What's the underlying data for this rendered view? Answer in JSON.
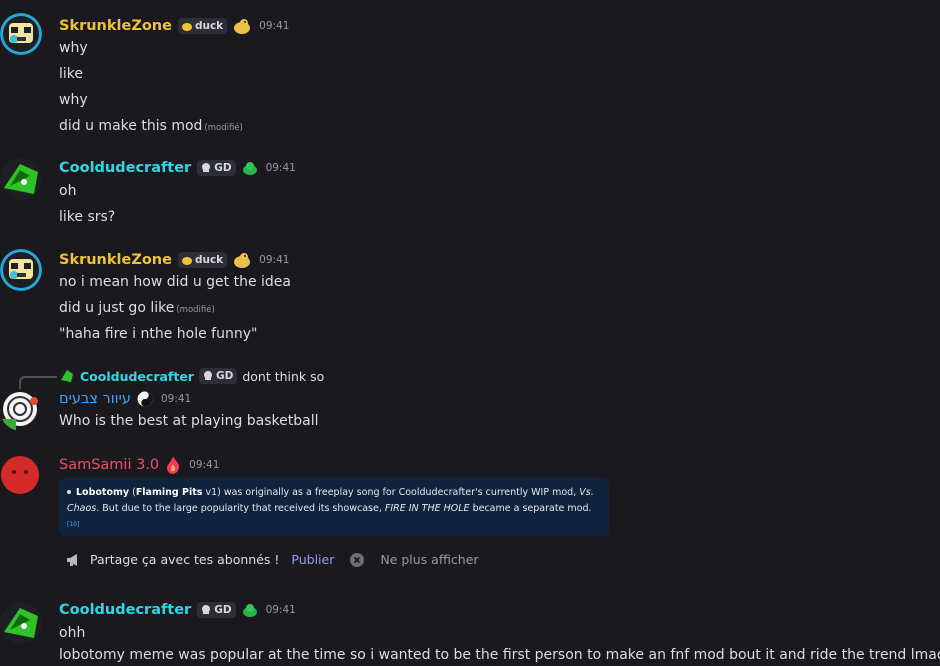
{
  "colors": {
    "skrunkle": "#f0c232",
    "cooldude": "#2bd9e6",
    "hebrew": "#3aa3ff",
    "samsamii": "#ef4d64"
  },
  "messages": [
    {
      "author": "SkrunkleZone",
      "tag": "duck",
      "time": "09:41",
      "lines": [
        "why",
        "like",
        "why",
        "did u make this mod"
      ],
      "edited": "(modifié)"
    },
    {
      "author": "Cooldudecrafter",
      "tag": "GD",
      "time": "09:41",
      "lines": [
        "oh",
        "like srs?"
      ]
    },
    {
      "author": "SkrunkleZone",
      "tag": "duck",
      "time": "09:41",
      "lines": [
        "no i mean how did  u get the idea",
        "did u just go like",
        "\"haha fire i nthe hole funny\""
      ],
      "edited": "(modifié)"
    },
    {
      "reply": {
        "author": "Cooldudecrafter",
        "tag": "GD",
        "text": "dont think so"
      },
      "author": "עיוור צבעים",
      "time": "09:41",
      "lines": [
        "Who is the best at playing basketball"
      ]
    },
    {
      "author": "SamSamii 3.0",
      "time": "09:41",
      "embed": {
        "t1": "Lobotomy",
        "t2": " (",
        "t3": "Flaming Pits",
        "t4": " v1) was originally as a freeplay song for Cooldudecrafter's currently WIP mod, ",
        "t5": "Vs. Chaos",
        "t6": ". But due to the large popularity that received its showcase, ",
        "t7": "FIRE IN THE HOLE",
        "t8": " became a separate mod.",
        "ref": "[10]"
      }
    },
    {
      "author": "Cooldudecrafter",
      "tag": "GD",
      "time": "09:41",
      "lines": [
        "ohh",
        "lobotomy meme was popular at the time so i wanted to be the first person to make an fnf mod bout it and ride the trend lmao"
      ]
    }
  ],
  "share": {
    "text": "Partage ça avec tes abonnés !",
    "publish": "Publier",
    "dismiss": "Ne plus afficher"
  }
}
